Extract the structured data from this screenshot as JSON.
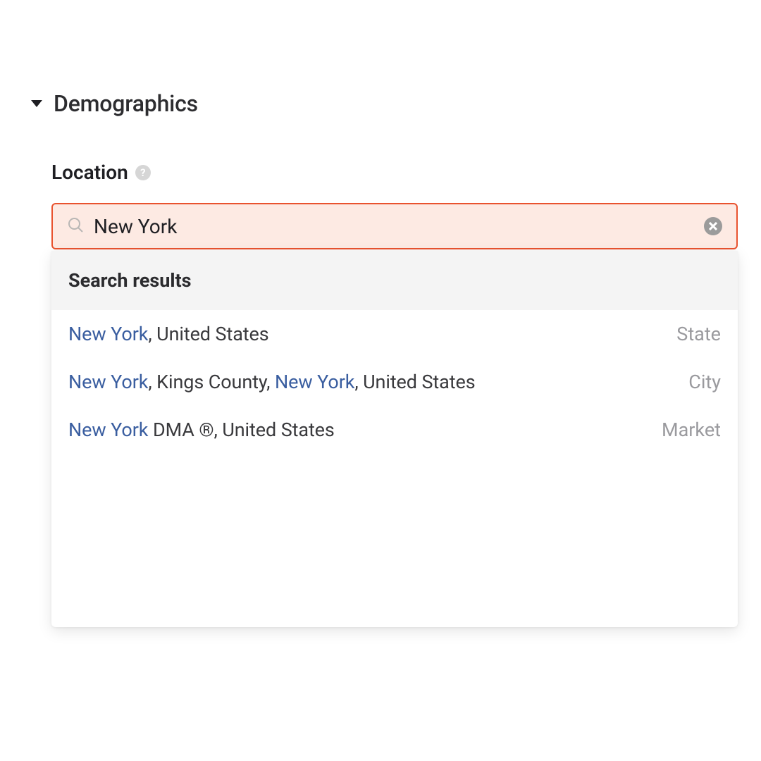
{
  "section": {
    "title": "Demographics"
  },
  "location": {
    "label": "Location",
    "search_value": "New York",
    "placeholder": "",
    "results_header": "Search results",
    "results": [
      {
        "segments": [
          {
            "text": "New York",
            "highlight": true
          },
          {
            "text": ", United States",
            "highlight": false
          }
        ],
        "type": "State"
      },
      {
        "segments": [
          {
            "text": "New York",
            "highlight": true
          },
          {
            "text": ", Kings County, ",
            "highlight": false
          },
          {
            "text": "New York",
            "highlight": true
          },
          {
            "text": ", United States",
            "highlight": false
          }
        ],
        "type": "City"
      },
      {
        "segments": [
          {
            "text": "New York",
            "highlight": true
          },
          {
            "text": " DMA ®, United States",
            "highlight": false
          }
        ],
        "type": "Market"
      }
    ]
  },
  "icons": {
    "help_glyph": "?"
  }
}
